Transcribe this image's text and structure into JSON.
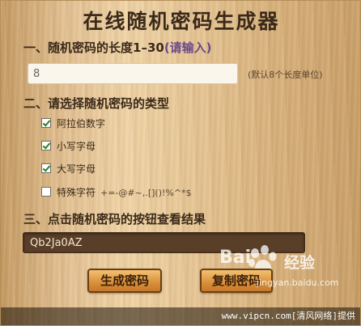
{
  "title": "在线随机密码生成器",
  "section1": {
    "heading": "一、随机密码的长度1–30",
    "hint": "(请输入)",
    "length_value": "8",
    "note": "(默认8个长度单位)"
  },
  "section2": {
    "heading": "二、请选择随机密码的类型",
    "options": [
      {
        "label": "阿拉伯数字",
        "checked": true
      },
      {
        "label": "小写字母",
        "checked": true
      },
      {
        "label": "大写字母",
        "checked": true
      },
      {
        "label": "特殊字符",
        "symbols": "+=-@#~,.[]()!%^*$",
        "checked": false
      }
    ]
  },
  "section3": {
    "heading": "三、点击随机密码的按钮查看结果",
    "result": "Qb2Ja0AZ"
  },
  "buttons": {
    "generate": "生成密码",
    "copy": "复制密码"
  },
  "watermark": {
    "brand": "Bai",
    "brand_suffix": "经验",
    "url": "jingyan.baidu.com"
  },
  "footer": {
    "text": "www.vipcn.com[清风网络]提供"
  },
  "colors": {
    "wood_light": "#f0d4a6",
    "wood_dark": "#c59b63",
    "text_dark": "#3b2a1a",
    "hint_purple": "#6a4a8a",
    "result_bg": "#5a3f28",
    "button_orange": "#d98f3a"
  }
}
